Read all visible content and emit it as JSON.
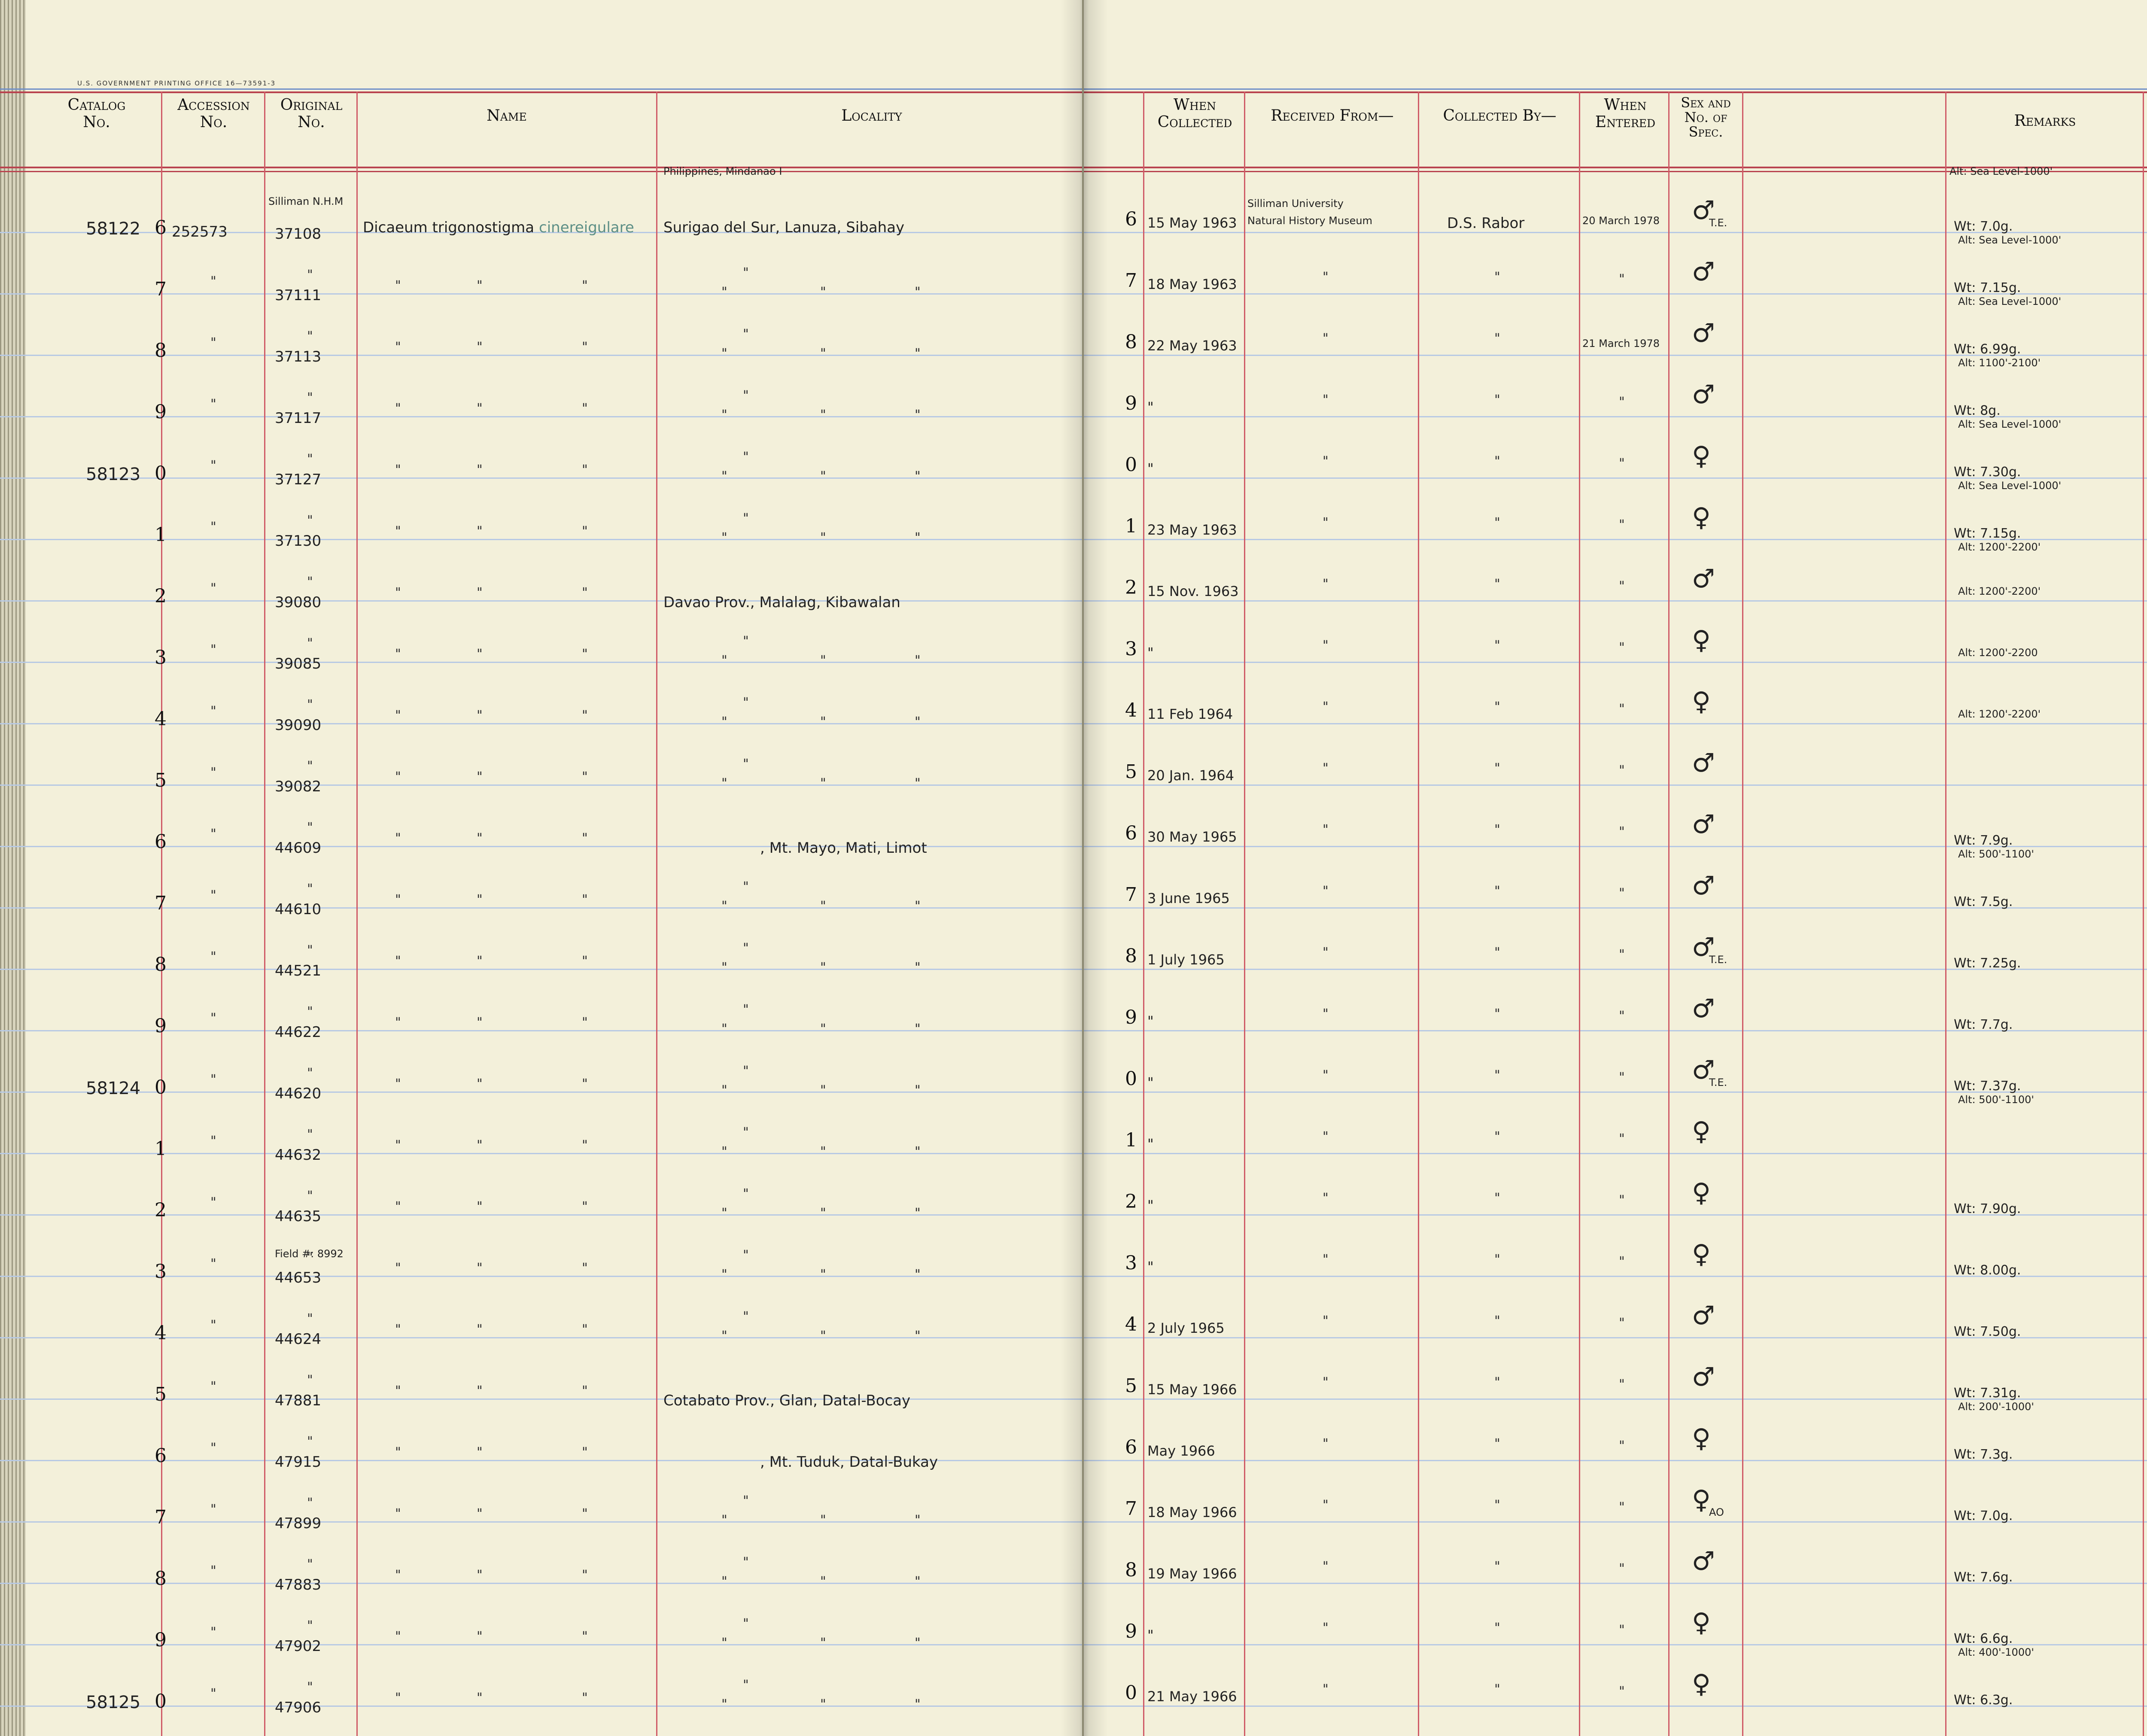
{
  "printer_line": "U.S. GOVERNMENT PRINTING OFFICE   16—73591-3",
  "headers_left": {
    "catalog": "Catalog\nNo.",
    "accession": "Accession\nNo.",
    "original": "Original\nNo.",
    "name": "Name",
    "locality": "Locality"
  },
  "headers_right": {
    "when_collected": "When\nCollected",
    "received_from": "Received From—",
    "collected_by": "Collected By—",
    "when_entered": "When\nEntered",
    "sex": "Sex and\nNo. of\nSpec.",
    "remarks": "Remarks"
  },
  "first_row": {
    "locality_note": "Philippines, Mindanao I",
    "original_note": "Silliman N.H.M",
    "name": "Dicaeum trigonostigma",
    "name_sub": "cinereigulare",
    "accession": "252573",
    "locality": "Surigao del Sur, Lanuza, Sibahay",
    "received_from_1": "Silliman University",
    "received_from_2": "Natural History Museum",
    "collected_by": "D.S. Rabor",
    "when_entered": "20 March 1978",
    "remarks_note": "Alt: Sea Level-1000'"
  },
  "ditto": "\"",
  "rows": [
    {
      "catalog": "58122",
      "digit": "6",
      "original": "37108",
      "collected": "15 May 1963",
      "sex": "♂",
      "sex_note": "T.E.",
      "remarks": "Wt: 7.0g.",
      "remarks2": "Alt: Sea Level-1000'",
      "entered": "20 March 1978"
    },
    {
      "catalog": "",
      "digit": "7",
      "original": "37111",
      "collected": "18 May 1963",
      "sex": "♂",
      "sex_note": "",
      "remarks": "Wt: 7.15g.",
      "remarks2": "Alt: Sea Level-1000'",
      "entered": ""
    },
    {
      "catalog": "",
      "digit": "8",
      "original": "37113",
      "collected": "22 May 1963",
      "sex": "♂",
      "sex_note": "",
      "remarks": "Wt: 6.99g.",
      "remarks2": "Alt: 1100'-2100'",
      "entered": "21 March 1978"
    },
    {
      "catalog": "",
      "digit": "9",
      "original": "37117",
      "collected": "\"",
      "sex": "♂",
      "sex_note": "",
      "remarks": "Wt: 8g.",
      "remarks2": "Alt: Sea Level-1000'",
      "entered": ""
    },
    {
      "catalog": "58123",
      "digit": "0",
      "original": "37127",
      "collected": "\"",
      "sex": "♀",
      "sex_note": "",
      "remarks": "Wt: 7.30g.",
      "remarks2": "Alt: Sea Level-1000'",
      "entered": ""
    },
    {
      "catalog": "",
      "digit": "1",
      "original": "37130",
      "collected": "23 May 1963",
      "sex": "♀",
      "sex_note": "",
      "remarks": "Wt: 7.15g.",
      "remarks2": "Alt: 1200'-2200'",
      "entered": ""
    },
    {
      "catalog": "",
      "digit": "2",
      "original": "39080",
      "collected": "15 Nov. 1963",
      "sex": "♂",
      "sex_note": "",
      "remarks": "",
      "remarks2": "Alt: 1200'-2200'",
      "entered": "",
      "locality": "Davao Prov., Malalag, Kibawalan"
    },
    {
      "catalog": "",
      "digit": "3",
      "original": "39085",
      "collected": "\"",
      "sex": "♀",
      "sex_note": "",
      "remarks": "",
      "remarks2": "Alt: 1200'-2200",
      "entered": ""
    },
    {
      "catalog": "",
      "digit": "4",
      "original": "39090",
      "collected": "11 Feb 1964",
      "sex": "♀",
      "sex_note": "",
      "remarks": "",
      "remarks2": "Alt: 1200'-2200'",
      "entered": ""
    },
    {
      "catalog": "",
      "digit": "5",
      "original": "39082",
      "collected": "20 Jan. 1964",
      "sex": "♂",
      "sex_note": "",
      "remarks": "",
      "remarks2": "",
      "entered": ""
    },
    {
      "catalog": "",
      "digit": "6",
      "original": "44609",
      "collected": "30 May 1965",
      "sex": "♂",
      "sex_note": "",
      "remarks": "Wt: 7.9g.",
      "remarks2": "Alt: 500'-1100'",
      "entered": "",
      "locality": ", Mt. Mayo, Mati, Limot"
    },
    {
      "catalog": "",
      "digit": "7",
      "original": "44610",
      "collected": "3 June 1965",
      "sex": "♂",
      "sex_note": "",
      "remarks": "Wt: 7.5g.",
      "remarks2": "",
      "entered": ""
    },
    {
      "catalog": "",
      "digit": "8",
      "original": "44521",
      "collected": "1 July 1965",
      "sex": "♂",
      "sex_note": "T.E.",
      "remarks": "Wt: 7.25g.",
      "remarks2": "",
      "entered": ""
    },
    {
      "catalog": "",
      "digit": "9",
      "original": "44622",
      "collected": "\"",
      "sex": "♂",
      "sex_note": "",
      "remarks": "Wt: 7.7g.",
      "remarks2": "",
      "entered": ""
    },
    {
      "catalog": "58124",
      "digit": "0",
      "original": "44620",
      "collected": "\"",
      "sex": "♂",
      "sex_note": "T.E.",
      "remarks": "Wt: 7.37g.",
      "remarks2": "Alt: 500'-1100'",
      "entered": ""
    },
    {
      "catalog": "",
      "digit": "1",
      "original": "44632",
      "collected": "\"",
      "sex": "♀",
      "sex_note": "",
      "remarks": "",
      "remarks2": "",
      "entered": ""
    },
    {
      "catalog": "",
      "digit": "2",
      "original": "44635",
      "collected": "\"",
      "sex": "♀",
      "sex_note": "",
      "remarks": "Wt: 7.90g.",
      "remarks2": "",
      "entered": ""
    },
    {
      "catalog": "",
      "digit": "3",
      "original": "44653",
      "original_note": "Field #: 8992",
      "collected": "\"",
      "sex": "♀",
      "sex_note": "",
      "remarks": "Wt: 8.00g.",
      "remarks2": "",
      "entered": ""
    },
    {
      "catalog": "",
      "digit": "4",
      "original": "44624",
      "collected": "2 July 1965",
      "sex": "♂",
      "sex_note": "",
      "remarks": "Wt: 7.50g.",
      "remarks2": "",
      "entered": ""
    },
    {
      "catalog": "",
      "digit": "5",
      "original": "47881",
      "collected": "15 May 1966",
      "sex": "♂",
      "sex_note": "",
      "remarks": "Wt: 7.31g.",
      "remarks2": "Alt: 200'-1000'",
      "entered": "",
      "locality": "Cotabato Prov., Glan, Datal-Bocay"
    },
    {
      "catalog": "",
      "digit": "6",
      "original": "47915",
      "collected": "May 1966",
      "sex": "♀",
      "sex_note": "",
      "remarks": "Wt: 7.3g.",
      "remarks2": "",
      "entered": "",
      "locality": ", Mt. Tuduk, Datal-Bukay"
    },
    {
      "catalog": "",
      "digit": "7",
      "original": "47899",
      "collected": "18 May 1966",
      "sex": "♀",
      "sex_note": "AO",
      "remarks": "Wt: 7.0g.",
      "remarks2": "",
      "entered": ""
    },
    {
      "catalog": "",
      "digit": "8",
      "original": "47883",
      "collected": "19 May 1966",
      "sex": "♂",
      "sex_note": "",
      "remarks": "Wt: 7.6g.",
      "remarks2": "",
      "entered": ""
    },
    {
      "catalog": "",
      "digit": "9",
      "original": "47902",
      "collected": "\"",
      "sex": "♀",
      "sex_note": "",
      "remarks": "Wt: 6.6g.",
      "remarks2": "Alt: 400'-1000'",
      "entered": ""
    },
    {
      "catalog": "58125",
      "digit": "0",
      "original": "47906",
      "collected": "21 May 1966",
      "sex": "♀",
      "sex_note": "",
      "remarks": "Wt: 6.3g.",
      "remarks2": "",
      "entered": ""
    }
  ]
}
